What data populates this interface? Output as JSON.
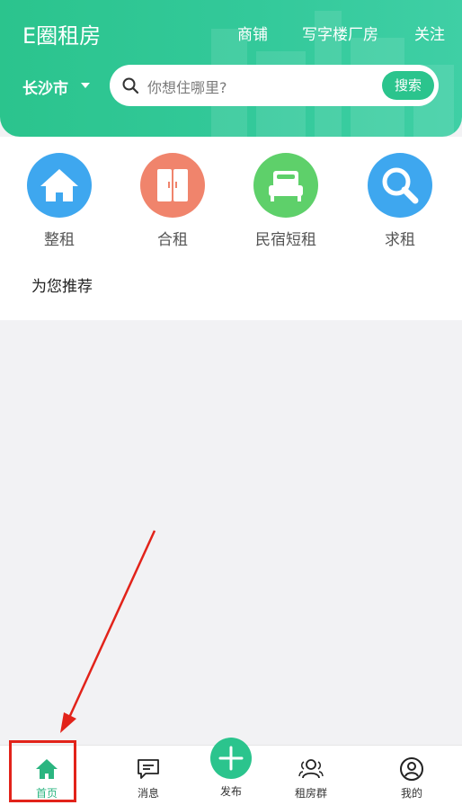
{
  "header": {
    "app_title": "E圈租房",
    "nav_links": [
      "商铺",
      "写字楼厂房",
      "关注"
    ],
    "city": "长沙市",
    "search": {
      "placeholder": "你想住哪里?",
      "button_label": "搜索"
    },
    "colors": {
      "brand": "#2bc48d"
    }
  },
  "categories": [
    {
      "label": "整租",
      "icon": "house-icon",
      "color": "#3ea7ef"
    },
    {
      "label": "合租",
      "icon": "wardrobe-icon",
      "color": "#f0846c"
    },
    {
      "label": "民宿短租",
      "icon": "bed-icon",
      "color": "#5ed06a"
    },
    {
      "label": "求租",
      "icon": "magnifier-icon",
      "color": "#3ea7ef"
    }
  ],
  "recommend_title": "为您推荐",
  "tabbar": {
    "tabs": [
      {
        "label": "首页",
        "icon": "home-icon",
        "active": true
      },
      {
        "label": "消息",
        "icon": "message-icon"
      },
      {
        "label": "发布",
        "icon": "plus-icon"
      },
      {
        "label": "租房群",
        "icon": "group-icon"
      },
      {
        "label": "我的",
        "icon": "profile-icon"
      }
    ],
    "active_color": "#2bb580"
  },
  "annotation": {
    "color": "#e2231a",
    "target": "首页"
  }
}
